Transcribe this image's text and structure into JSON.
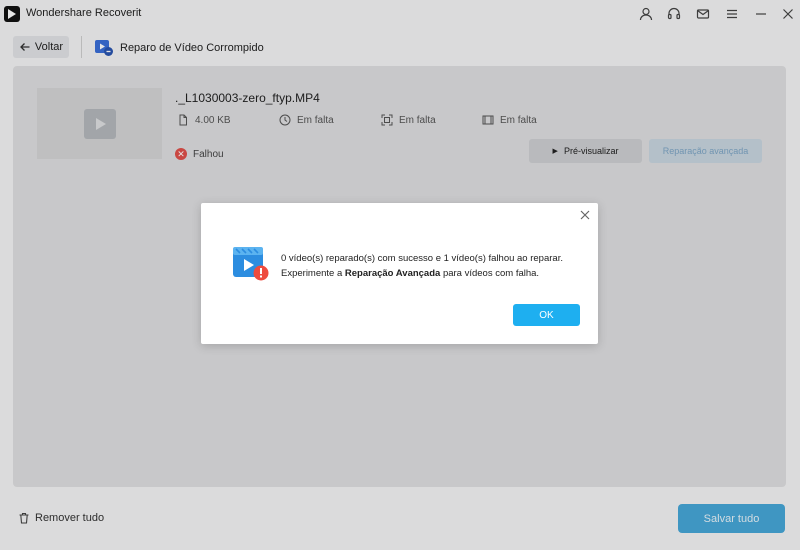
{
  "app": {
    "title": "Wondershare Recoverit"
  },
  "window_icons": [
    "user-icon",
    "headset-icon",
    "mail-icon",
    "menu-icon",
    "minimize-icon",
    "close-icon"
  ],
  "toolbar": {
    "back_label": "Voltar",
    "tool_title": "Reparo de Vídeo Corrompido"
  },
  "file": {
    "name": "._L1030003-zero_ftyp.MP4",
    "size": "4.00  KB",
    "duration": "Em falta",
    "resolution": "Em falta",
    "frame": "Em falta",
    "status": "Falhou"
  },
  "actions": {
    "preview_label": "Pré-visualizar",
    "advanced_label": "Reparação avançada"
  },
  "bottom": {
    "remove_all_label": "Remover tudo",
    "save_all_label": "Salvar tudo"
  },
  "dialog": {
    "line1": "0 vídeo(s) reparado(s) com sucesso e 1 vídeo(s) falhou ao reparar.",
    "line2_prefix": "Experimente a ",
    "line2_bold": "Reparação Avançada",
    "line2_suffix": " para vídeos com falha.",
    "ok_label": "OK"
  },
  "colors": {
    "accent": "#1eaff0",
    "save_button": "#47a7d9",
    "error": "#e0504a"
  }
}
